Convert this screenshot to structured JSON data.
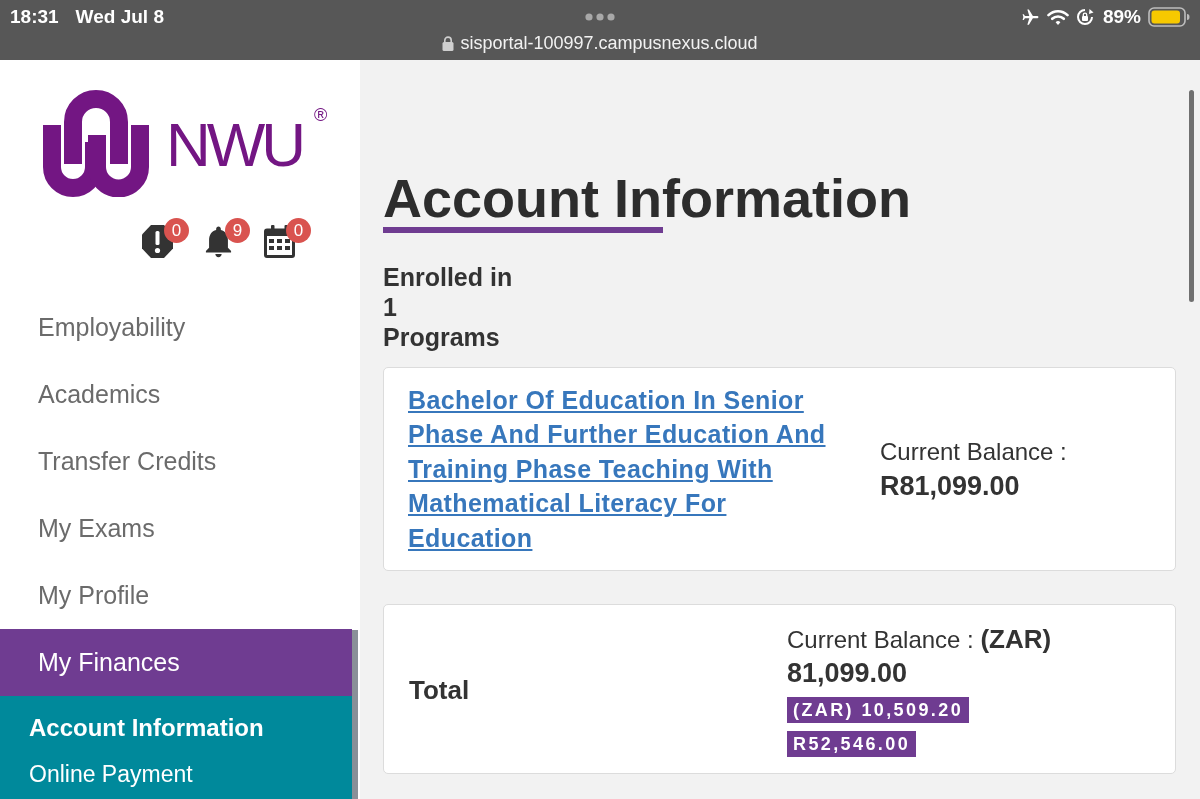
{
  "status_bar": {
    "time": "18:31",
    "date": "Wed Jul 8",
    "url": "sisportal-100997.campusnexus.cloud",
    "battery": "89%"
  },
  "sidebar": {
    "logo": {
      "text": "NWU",
      "mark": "®"
    },
    "indicators": [
      {
        "kind": "alert",
        "count": "0"
      },
      {
        "kind": "bell",
        "count": "9"
      },
      {
        "kind": "calendar",
        "count": "0"
      }
    ],
    "items": [
      {
        "label": "Employability",
        "selected": false
      },
      {
        "label": "Academics",
        "selected": false
      },
      {
        "label": "Transfer Credits",
        "selected": false
      },
      {
        "label": "My Exams",
        "selected": false
      },
      {
        "label": "My Profile",
        "selected": false
      },
      {
        "label": "My Finances",
        "selected": true,
        "children": [
          {
            "label": "Account Information",
            "selected": true
          },
          {
            "label": "Online Payment",
            "selected": false
          }
        ]
      }
    ]
  },
  "main": {
    "title": "Account Information",
    "enrolled": {
      "label": "Enrolled in",
      "count": "1",
      "unit": "Programs"
    },
    "programs": [
      {
        "name": "Bachelor Of Education In Senior Phase And Further Education And Training Phase Teaching With Mathematical Literacy For Education",
        "balance_label": "Current Balance :",
        "balance": "R81,099.00"
      }
    ],
    "total": {
      "label": "Total",
      "balance_label": "Current Balance : **(ZAR)**",
      "balance": "81,099.00",
      "badges": [
        "(ZAR) 10,509.20",
        "R52,546.00"
      ]
    }
  }
}
